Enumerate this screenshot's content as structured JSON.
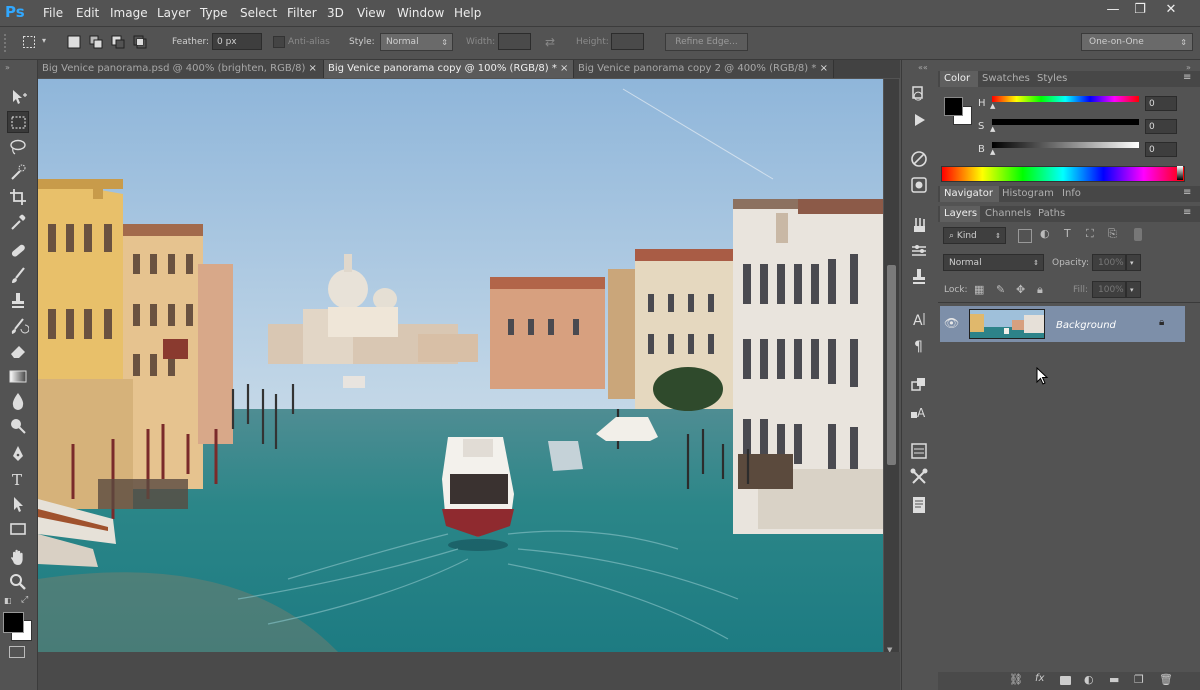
{
  "app": {
    "logo": "Ps"
  },
  "menu": [
    "File",
    "Edit",
    "Image",
    "Layer",
    "Type",
    "Select",
    "Filter",
    "3D",
    "View",
    "Window",
    "Help"
  ],
  "window_controls": {
    "minimize": "—",
    "restore": "❐",
    "close": "✕"
  },
  "options": {
    "feather_label": "Feather:",
    "feather_value": "0 px",
    "antialias_label": "Anti-alias",
    "style_label": "Style:",
    "style_value": "Normal",
    "width_label": "Width:",
    "height_label": "Height:",
    "refine_edge": "Refine Edge...",
    "workspace": "One-on-One"
  },
  "tabs": [
    {
      "label": "Big Venice panorama.psd @ 400% (brighten, RGB/8)",
      "close": "×"
    },
    {
      "label": "Big Venice panorama copy @ 100% (RGB/8) *",
      "close": "×"
    },
    {
      "label": "Big Venice panorama copy 2 @ 400% (RGB/8) *",
      "close": "×"
    }
  ],
  "color_panel": {
    "tabs": [
      "Color",
      "Swatches",
      "Styles"
    ],
    "sliders": [
      {
        "label": "H",
        "value": "0"
      },
      {
        "label": "S",
        "value": "0"
      },
      {
        "label": "B",
        "value": "0"
      }
    ]
  },
  "nav_panel": {
    "tabs": [
      "Navigator",
      "Histogram",
      "Info"
    ]
  },
  "layers_panel": {
    "tabs": [
      "Layers",
      "Channels",
      "Paths"
    ],
    "kind_label": "Kind",
    "blend_mode": "Normal",
    "opacity_label": "Opacity:",
    "opacity_value": "100%",
    "lock_label": "Lock:",
    "fill_label": "Fill:",
    "fill_value": "100%",
    "layer_name": "Background"
  },
  "colors": {
    "accent": "#31a8ff",
    "panel": "#535353",
    "selected_layer": "#7d8fa9"
  }
}
